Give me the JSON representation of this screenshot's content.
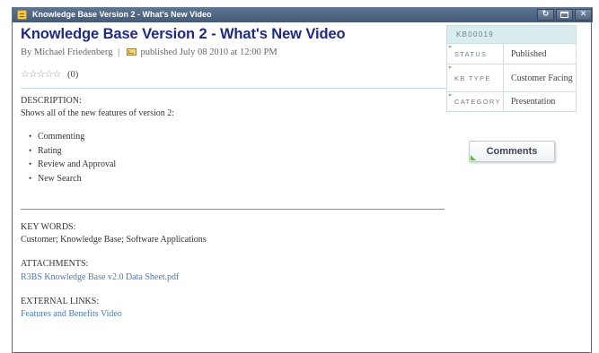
{
  "window": {
    "title": "Knowledge Base Version 2 - What's New Video",
    "controls": {
      "refresh_icon": "refresh-icon",
      "maximize_icon": "maximize-icon",
      "close_icon": "close-icon"
    }
  },
  "article": {
    "title": "Knowledge Base Version 2 - What's New Video",
    "author": "By Michael Friedenberg",
    "separator": "|",
    "published": "published July 08 2010 at 12:00 PM",
    "rating": {
      "stars_filled": 0,
      "stars_total": 5,
      "count_text": "(0)"
    },
    "description_label": "DESCRIPTION:",
    "description_text": "Shows all of the new features of version 2:",
    "features": [
      "Commenting",
      "Rating",
      "Review and Approval",
      "New Search"
    ],
    "keywords_label": "KEY WORDS:",
    "keywords": "Customer; Knowledge Base; Software Applications",
    "attachments_label": "ATTACHMENTS:",
    "attachment": "R3BS Knowledge Base v2.0 Data Sheet.pdf",
    "external_links_label": "EXTERNAL LINKS:",
    "external_link": "Features and Benefits Video"
  },
  "metadata": {
    "id": "KB00019",
    "rows": [
      {
        "key": "STATUS",
        "value": "Published"
      },
      {
        "key": "KB TYPE",
        "value": "Customer Facing"
      },
      {
        "key": "CATEGORY",
        "value": "Presentation"
      }
    ]
  },
  "comments_button": {
    "label": "Comments"
  },
  "colors": {
    "title_blue": "#1f2a80",
    "link_blue": "#4a78b8",
    "titlebar": "#4d6380",
    "divider_red": "#d96a6a",
    "meta_header": "#d9ecef"
  }
}
